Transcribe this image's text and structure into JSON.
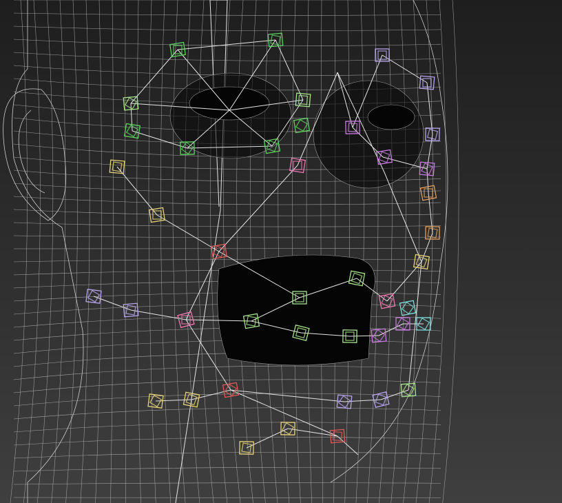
{
  "scene": {
    "description_free": true,
    "colors": {
      "background_top": "#1e1e1e",
      "background_bottom": "#3f3f3f",
      "wireframe": "#cfcfcf",
      "dense_mesh": "#050505"
    }
  },
  "rig_controls": {
    "colors": {
      "green": "#5fd35f",
      "light_green": "#a8e68a",
      "lavender": "#b9a6ee",
      "purple": "#c77ae0",
      "pink": "#ee7ab0",
      "red": "#e05a5a",
      "yellow": "#e7d47a",
      "orange": "#e0a060",
      "cyan": "#7fdede"
    }
  }
}
